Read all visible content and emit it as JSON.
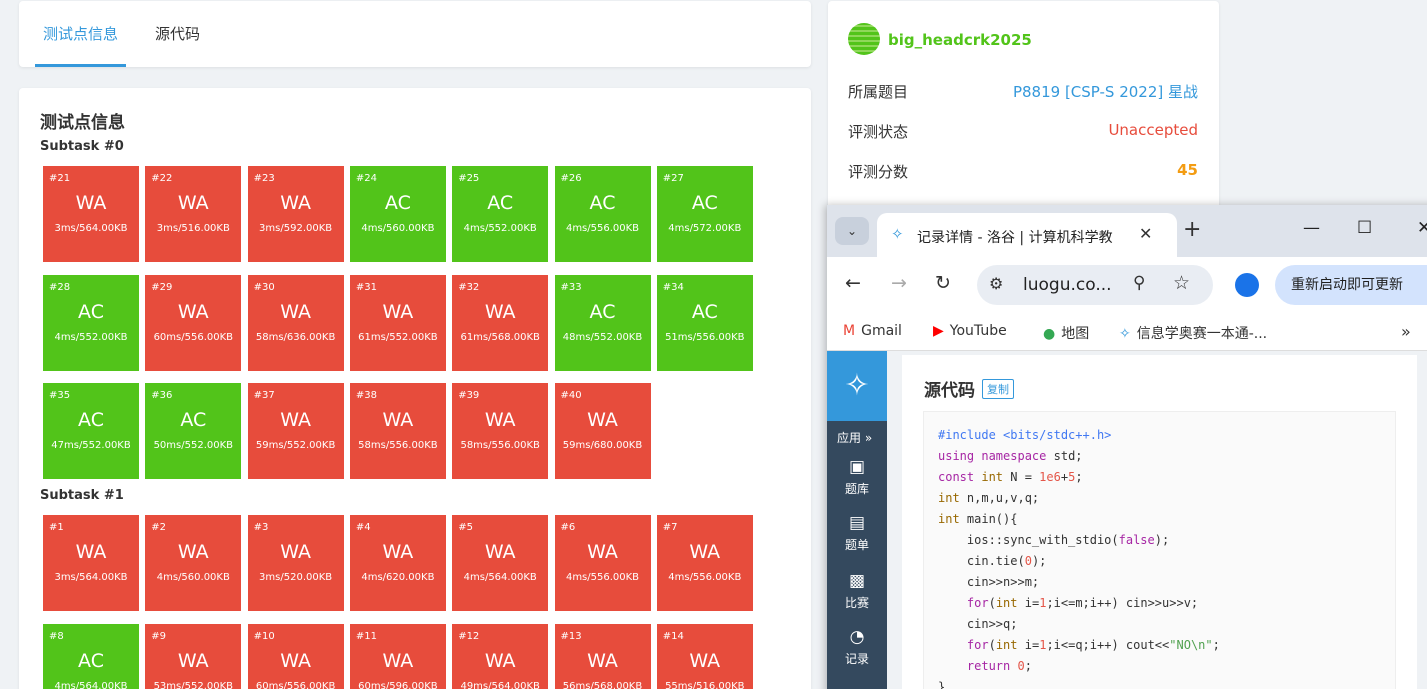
{
  "tabs": [
    "测试点信息",
    "源代码"
  ],
  "testcases": {
    "title": "测试点信息",
    "subtasks": [
      {
        "name": "Subtask #0",
        "cases": [
          {
            "num": "#21",
            "status": "WA",
            "result": "3ms/564.00KB"
          },
          {
            "num": "#22",
            "status": "WA",
            "result": "3ms/516.00KB"
          },
          {
            "num": "#23",
            "status": "WA",
            "result": "3ms/592.00KB"
          },
          {
            "num": "#24",
            "status": "AC",
            "result": "4ms/560.00KB"
          },
          {
            "num": "#25",
            "status": "AC",
            "result": "4ms/552.00KB"
          },
          {
            "num": "#26",
            "status": "AC",
            "result": "4ms/556.00KB"
          },
          {
            "num": "#27",
            "status": "AC",
            "result": "4ms/572.00KB"
          },
          {
            "num": "#28",
            "status": "AC",
            "result": "4ms/552.00KB"
          },
          {
            "num": "#29",
            "status": "WA",
            "result": "60ms/556.00KB"
          },
          {
            "num": "#30",
            "status": "WA",
            "result": "58ms/636.00KB"
          },
          {
            "num": "#31",
            "status": "WA",
            "result": "61ms/552.00KB"
          },
          {
            "num": "#32",
            "status": "WA",
            "result": "61ms/568.00KB"
          },
          {
            "num": "#33",
            "status": "AC",
            "result": "48ms/552.00KB"
          },
          {
            "num": "#34",
            "status": "AC",
            "result": "51ms/556.00KB"
          },
          {
            "num": "#35",
            "status": "AC",
            "result": "47ms/552.00KB"
          },
          {
            "num": "#36",
            "status": "AC",
            "result": "50ms/552.00KB"
          },
          {
            "num": "#37",
            "status": "WA",
            "result": "59ms/552.00KB"
          },
          {
            "num": "#38",
            "status": "WA",
            "result": "58ms/556.00KB"
          },
          {
            "num": "#39",
            "status": "WA",
            "result": "58ms/556.00KB"
          },
          {
            "num": "#40",
            "status": "WA",
            "result": "59ms/680.00KB"
          }
        ]
      },
      {
        "name": "Subtask #1",
        "cases": [
          {
            "num": "#1",
            "status": "WA",
            "result": "3ms/564.00KB"
          },
          {
            "num": "#2",
            "status": "WA",
            "result": "4ms/560.00KB"
          },
          {
            "num": "#3",
            "status": "WA",
            "result": "3ms/520.00KB"
          },
          {
            "num": "#4",
            "status": "WA",
            "result": "4ms/620.00KB"
          },
          {
            "num": "#5",
            "status": "WA",
            "result": "4ms/564.00KB"
          },
          {
            "num": "#6",
            "status": "WA",
            "result": "4ms/556.00KB"
          },
          {
            "num": "#7",
            "status": "WA",
            "result": "4ms/556.00KB"
          },
          {
            "num": "#8",
            "status": "AC",
            "result": "4ms/564.00KB"
          },
          {
            "num": "#9",
            "status": "WA",
            "result": "53ms/552.00KB"
          },
          {
            "num": "#10",
            "status": "WA",
            "result": "60ms/556.00KB"
          },
          {
            "num": "#11",
            "status": "WA",
            "result": "60ms/596.00KB"
          },
          {
            "num": "#12",
            "status": "WA",
            "result": "49ms/564.00KB"
          },
          {
            "num": "#13",
            "status": "WA",
            "result": "56ms/568.00KB"
          },
          {
            "num": "#14",
            "status": "WA",
            "result": "55ms/516.00KB"
          }
        ]
      }
    ]
  },
  "info": {
    "username": "big_headcrk2025",
    "rows": [
      {
        "label": "所属题目",
        "value": "P8819 [CSP-S 2022] 星战",
        "color": "#3498db"
      },
      {
        "label": "评测状态",
        "value": "Unaccepted",
        "color": "#e74c3c"
      },
      {
        "label": "评测分数",
        "value": "45",
        "color": "#f39c12"
      }
    ]
  },
  "browser": {
    "tab_title": "记录详情 - 洛谷 | 计算机科学教",
    "url": "luogu.co...",
    "update_label": "重新启动即可更新",
    "bookmarks": [
      "Gmail",
      "YouTube",
      "地图",
      "信息学奥赛一本通-..."
    ],
    "sidebar": {
      "app_label": "应用 »",
      "items": [
        "题库",
        "题单",
        "比赛",
        "记录"
      ]
    },
    "code_title": "源代码",
    "copy_label": "复制",
    "code_lines": [
      "#include <bits/stdc++.h>",
      "using namespace std;",
      "const int N = 1e6+5;",
      "int n,m,u,v,q;",
      "int main(){",
      "    ios::sync_with_stdio(false);",
      "    cin.tie(0);",
      "    cin>>n>>m;",
      "    for(int i=1;i<=m;i++) cin>>u>>v;",
      "    cin>>q;",
      "    for(int i=1;i<=q;i++) cout<<\"NO\\n\";",
      "    return 0;",
      "}"
    ]
  },
  "colors": {
    "wa": "#e74c3c",
    "ac": "#52c41a",
    "accent": "#3498db"
  }
}
